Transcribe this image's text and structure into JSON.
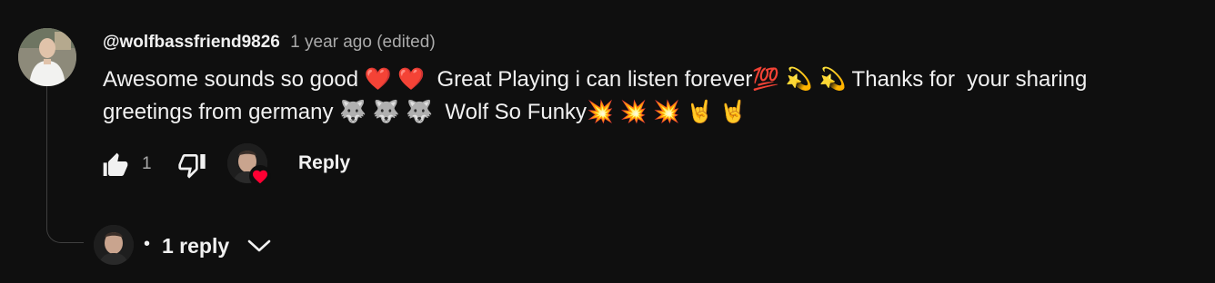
{
  "comment": {
    "author": "@wolfbassfriend9826",
    "meta": "1 year ago (edited)",
    "text": "Awesome sounds so good ❤️ ❤️  Great Playing i can listen forever💯 💫 💫 Thanks for  your sharing greetings from germany 🐺 🐺 🐺  Wolf So Funky💥 💥 💥 🤘 🤘",
    "like_count": "1",
    "reply_label": "Reply"
  },
  "replies": {
    "dot": "•",
    "label": "1 reply"
  },
  "icons": {
    "like": "thumb-up-icon",
    "dislike": "thumb-down-icon",
    "heart": "heart-icon",
    "chevron": "chevron-down-icon"
  },
  "colors": {
    "background": "#0f0f0f",
    "text": "#f1f1f1",
    "secondary_text": "#aaaaaa",
    "heart": "#ff0033",
    "thread_line": "#3f3f3f"
  }
}
